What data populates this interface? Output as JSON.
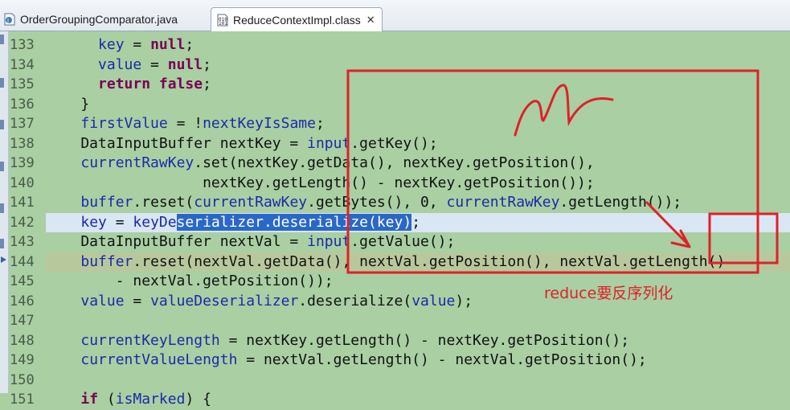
{
  "tabs": [
    {
      "label": "OrderGroupingComparator.java",
      "active": false
    },
    {
      "label": "ReduceContextImpl.class",
      "active": true,
      "close": "✕"
    }
  ],
  "colors": {
    "editor_bg": "#a9cfa3",
    "keyword": "#7a0055",
    "field": "#1c2aa8",
    "selection": "#2a68c8",
    "annotation": "#e0202a"
  },
  "editor": {
    "line_numbers": [
      "133",
      "134",
      "135",
      "136",
      "137",
      "138",
      "139",
      "140",
      "141",
      "142",
      "143",
      "144",
      "145",
      "146",
      "147",
      "148",
      "149",
      "150",
      "151"
    ],
    "lines": [
      {
        "tokens": [
          {
            "t": "      "
          },
          {
            "t": "key",
            "c": "fld"
          },
          {
            "t": " = "
          },
          {
            "t": "null",
            "c": "kw"
          },
          {
            "t": ";"
          }
        ]
      },
      {
        "tokens": [
          {
            "t": "      "
          },
          {
            "t": "value",
            "c": "fld"
          },
          {
            "t": " = "
          },
          {
            "t": "null",
            "c": "kw"
          },
          {
            "t": ";"
          }
        ]
      },
      {
        "tokens": [
          {
            "t": "      "
          },
          {
            "t": "return",
            "c": "kw"
          },
          {
            "t": " "
          },
          {
            "t": "false",
            "c": "kw"
          },
          {
            "t": ";"
          }
        ]
      },
      {
        "tokens": [
          {
            "t": "    }"
          }
        ]
      },
      {
        "tokens": [
          {
            "t": "    "
          },
          {
            "t": "firstValue",
            "c": "fld"
          },
          {
            "t": " = !"
          },
          {
            "t": "nextKeyIsSame",
            "c": "fld"
          },
          {
            "t": ";"
          }
        ]
      },
      {
        "tokens": [
          {
            "t": "    DataInputBuffer nextKey = "
          },
          {
            "t": "input",
            "c": "fld"
          },
          {
            "t": ".getKey();"
          }
        ]
      },
      {
        "tokens": [
          {
            "t": "    "
          },
          {
            "t": "currentRawKey",
            "c": "fld"
          },
          {
            "t": ".set(nextKey.getData(), nextKey.getPosition(),"
          }
        ]
      },
      {
        "tokens": [
          {
            "t": "                  nextKey.getLength() - nextKey.getPosition());"
          }
        ]
      },
      {
        "tokens": [
          {
            "t": "    "
          },
          {
            "t": "buffer",
            "c": "fld"
          },
          {
            "t": ".reset("
          },
          {
            "t": "currentRawKey",
            "c": "fld"
          },
          {
            "t": ".getBytes(), 0, "
          },
          {
            "t": "currentRawKey",
            "c": "fld"
          },
          {
            "t": ".getLength());"
          }
        ]
      },
      {
        "highlight": "hl",
        "tokens": [
          {
            "t": "    "
          },
          {
            "t": "key",
            "c": "fld"
          },
          {
            "t": " = "
          },
          {
            "t": "keyDe",
            "c": "fld"
          },
          {
            "t": "serializer.deserialize(key)",
            "c": "sel"
          },
          {
            "t": ";"
          }
        ]
      },
      {
        "tokens": [
          {
            "t": "    DataInputBuffer nextVal = "
          },
          {
            "t": "input",
            "c": "fld"
          },
          {
            "t": ".getValue();"
          }
        ]
      },
      {
        "highlight": "cur",
        "tokens": [
          {
            "t": "    "
          },
          {
            "t": "buffer",
            "c": "fld"
          },
          {
            "t": ".reset(nextVal.getData(), nextVal.getPosition(), nextVal.getLength()"
          }
        ]
      },
      {
        "tokens": [
          {
            "t": "        - nextVal.getPosition());"
          }
        ]
      },
      {
        "tokens": [
          {
            "t": "    "
          },
          {
            "t": "value",
            "c": "fld"
          },
          {
            "t": " = "
          },
          {
            "t": "valueDeserializer",
            "c": "fld"
          },
          {
            "t": ".deserialize("
          },
          {
            "t": "value",
            "c": "fld"
          },
          {
            "t": ");"
          }
        ]
      },
      {
        "tokens": [
          {
            "t": ""
          }
        ]
      },
      {
        "tokens": [
          {
            "t": "    "
          },
          {
            "t": "currentKeyLength",
            "c": "fld"
          },
          {
            "t": " = nextKey.getLength() - nextKey.getPosition();"
          }
        ]
      },
      {
        "tokens": [
          {
            "t": "    "
          },
          {
            "t": "currentValueLength",
            "c": "fld"
          },
          {
            "t": " = nextVal.getLength() - nextVal.getPosition();"
          }
        ]
      },
      {
        "tokens": [
          {
            "t": ""
          }
        ]
      },
      {
        "tokens": [
          {
            "t": "    "
          },
          {
            "t": "if",
            "c": "kw"
          },
          {
            "t": " ("
          },
          {
            "t": "isMarked",
            "c": "fld"
          },
          {
            "t": ") {"
          }
        ]
      }
    ]
  },
  "annotation": {
    "text": "reduce要反序列化"
  }
}
